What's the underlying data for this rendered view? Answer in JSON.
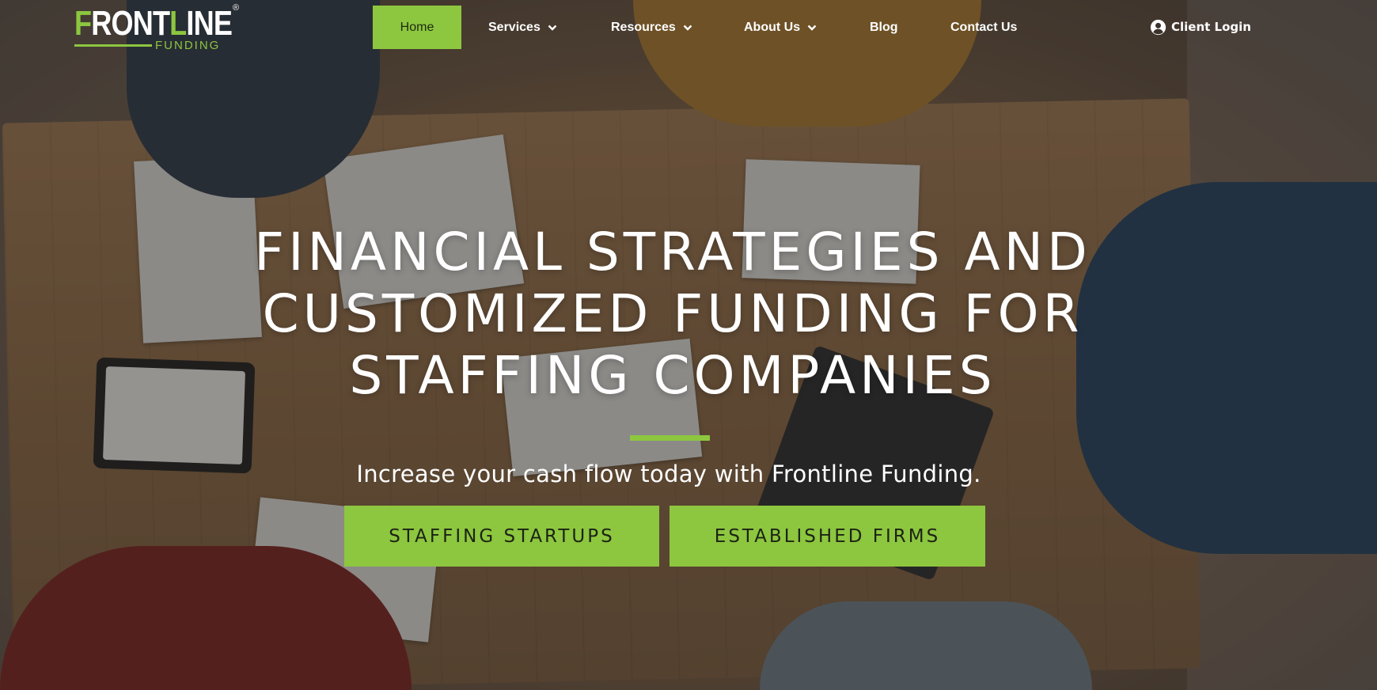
{
  "logo": {
    "word_part1": "F",
    "word_part2": "RONT",
    "word_part3": "L",
    "word_part4": "INE",
    "registered": "®",
    "sub": "FUNDING"
  },
  "nav": {
    "items": [
      {
        "label": "Home",
        "active": true
      },
      {
        "label": "Services",
        "dropdown": true
      },
      {
        "label": "Resources",
        "dropdown": true
      },
      {
        "label": "About Us",
        "dropdown": true
      },
      {
        "label": "Blog"
      },
      {
        "label": "Contact Us"
      }
    ],
    "client_login": "Client Login"
  },
  "hero": {
    "title_lines": [
      "FINANCIAL STRATEGIES AND",
      "CUSTOMIZED FUNDING FOR",
      "STAFFING COMPANIES"
    ],
    "subtitle": "Increase your cash flow today with Frontline Funding.",
    "buttons": [
      {
        "label": "STAFFING STARTUPS"
      },
      {
        "label": "ESTABLISHED FIRMS"
      }
    ]
  },
  "colors": {
    "accent": "#8dc63f",
    "text": "#ffffff",
    "button_text": "#1c2314"
  }
}
